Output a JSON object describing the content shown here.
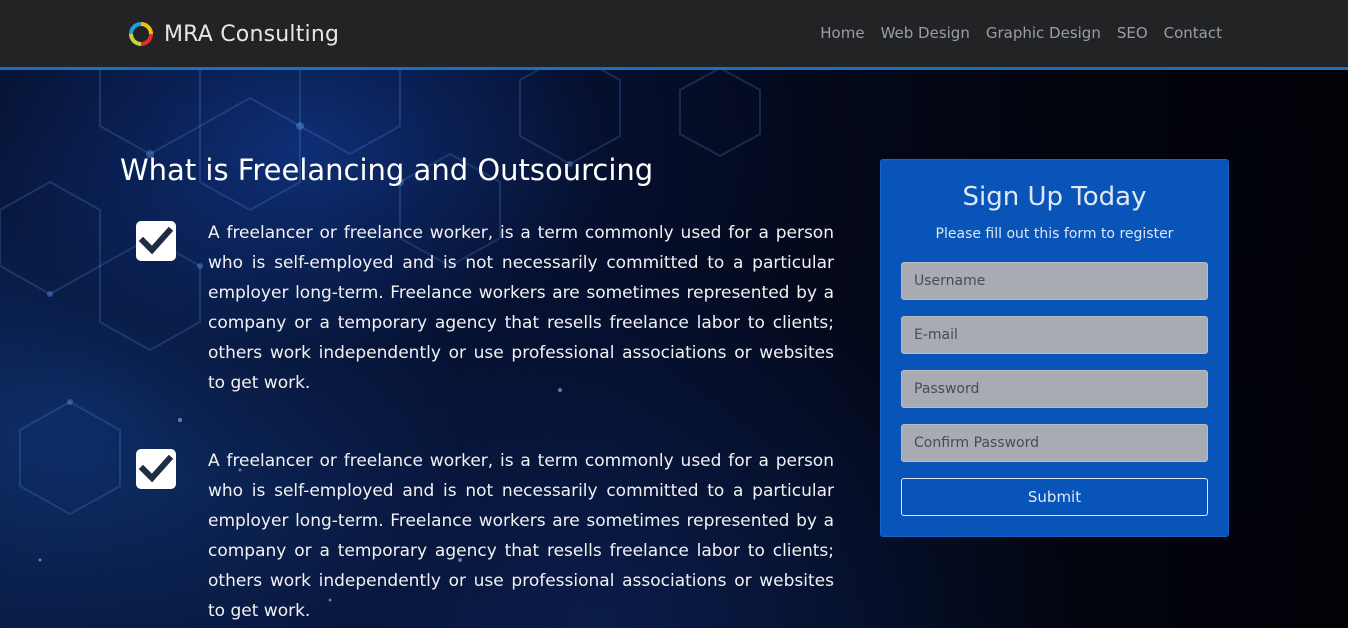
{
  "brand": {
    "name": "MRA Consulting",
    "logo_icon": "circular-arrows-logo",
    "logo_colors": [
      "#f2c200",
      "#e0322a",
      "#2a9ae0"
    ]
  },
  "nav": {
    "links": [
      "Home",
      "Web Design",
      "Graphic Design",
      "SEO",
      "Contact"
    ]
  },
  "colors": {
    "accent": "#1b6fc2",
    "card_bg": "#0854b8",
    "navbar_bg": "#222325"
  },
  "content": {
    "title": "What is Freelancing and Outsourcing",
    "features": [
      {
        "icon": "checkbox-checked-icon",
        "text": "A freelancer or freelance worker, is a term commonly used for a person who is self-employed and is not necessarily committed to a particular employer long-term. Freelance workers are sometimes represented by a company or a temporary agency that resells freelance labor to clients; others work independently or use professional associations or websites to get work."
      },
      {
        "icon": "checkbox-checked-icon",
        "text": "A freelancer or freelance worker, is a term commonly used for a person who is self-employed and is not necessarily committed to a particular employer long-term. Freelance workers are sometimes represented by a company or a temporary agency that resells freelance labor to clients; others work independently or use professional associations or websites to get work."
      }
    ]
  },
  "signup": {
    "title": "Sign Up Today",
    "subtitle": "Please fill out this form to register",
    "fields": {
      "username": {
        "placeholder": "Username",
        "value": ""
      },
      "email": {
        "placeholder": "E-mail",
        "value": ""
      },
      "password": {
        "placeholder": "Password",
        "value": ""
      },
      "confirm_password": {
        "placeholder": "Confirm Password",
        "value": ""
      }
    },
    "submit_label": "Submit"
  }
}
